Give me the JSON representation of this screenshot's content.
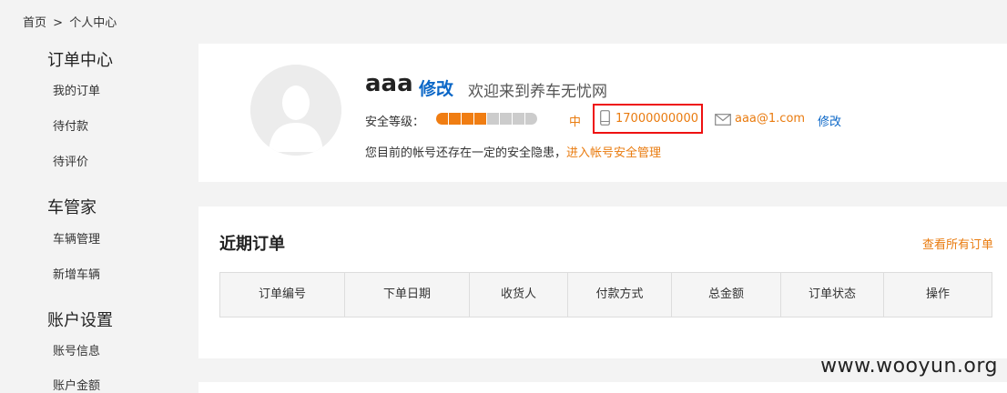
{
  "breadcrumb": {
    "home": "首页",
    "sep": ">",
    "current": "个人中心"
  },
  "sidebar": {
    "orders_head": "订单中心",
    "orders_items": [
      "我的订单",
      "待付款",
      "待评价"
    ],
    "car_head": "车管家",
    "car_items": [
      "车辆管理",
      "新增车辆"
    ],
    "account_head": "账户设置",
    "account_items": [
      "账号信息",
      "账户金额"
    ]
  },
  "profile": {
    "username": "aaa",
    "edit_label": "修改",
    "welcome": "欢迎来到养车无忧网",
    "security_label": "安全等级：",
    "security_segments_filled": 4,
    "security_segments_total": 8,
    "security_level": "中",
    "phone": "17000000000",
    "email": "aaa@1.com",
    "email_edit": "修改",
    "warning": "您目前的帐号还存在一定的安全隐患",
    "warning_sep": "，",
    "warning_link": "进入帐号安全管理"
  },
  "orders": {
    "title": "近期订单",
    "view_all": "查看所有订单",
    "columns": [
      "订单编号",
      "下单日期",
      "收货人",
      "付款方式",
      "总金额",
      "订单状态",
      "操作"
    ]
  },
  "watermark": "www.wooyun.org",
  "colors": {
    "accent": "#e97b0f",
    "link": "#0b67c7",
    "highlight_border": "#e11111",
    "seg_filled": "#f07d12",
    "seg_empty": "#cccccc"
  }
}
